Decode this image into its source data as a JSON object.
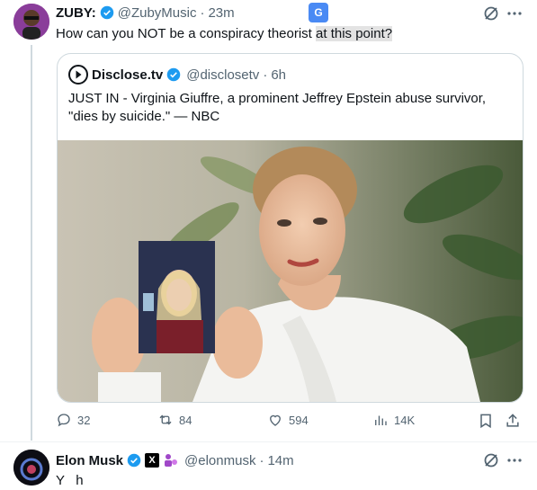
{
  "tweet": {
    "author_name": "ZUBY:",
    "author_handle": "@ZubyMusic",
    "separator": "·",
    "time": "23m",
    "text_main": "How can you NOT be a conspiracy theorist ",
    "text_highlight": "at this point?"
  },
  "quote": {
    "author_name": "Disclose.tv",
    "author_handle": "@disclosetv",
    "separator": "·",
    "time": "6h",
    "text": "JUST IN - Virginia Giuffre, a prominent Jeffrey Epstein abuse survivor, \"dies by suicide.\" — NBC"
  },
  "actions": {
    "replies": "32",
    "reposts": "84",
    "likes": "594",
    "views": "14K"
  },
  "reply": {
    "author_name": "Elon Musk",
    "author_handle": "@elonmusk",
    "separator": "·",
    "time": "14m",
    "text_partial": "Y   h"
  },
  "colors": {
    "verified_blue": "#1d9bf0",
    "text_primary": "#0f1419",
    "text_secondary": "#536471",
    "translate_badge": "#4a8af4"
  },
  "icons": [
    "translate-icon",
    "grok-icon",
    "more-icon",
    "reply-icon",
    "repost-icon",
    "like-icon",
    "views-icon",
    "bookmark-icon",
    "share-icon",
    "x-logo-icon",
    "affiliate-icon"
  ]
}
